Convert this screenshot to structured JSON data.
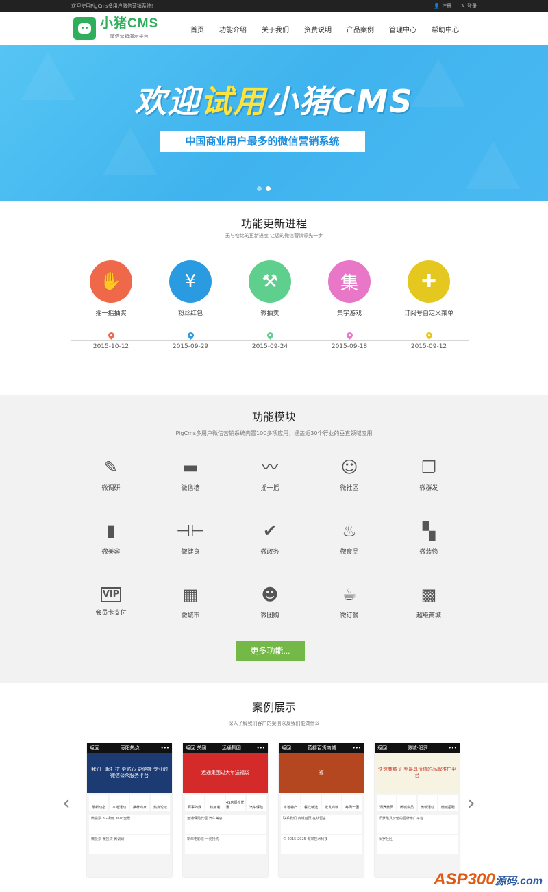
{
  "topbar": {
    "welcome": "欢迎使用PigCms多用户微信营销系统!",
    "register": "注册",
    "login": "登录"
  },
  "logo": {
    "title": "小猪CMS",
    "subtitle": "微信营销演示平台"
  },
  "nav": [
    "首页",
    "功能介绍",
    "关于我们",
    "资费说明",
    "产品案例",
    "管理中心",
    "帮助中心"
  ],
  "banner": {
    "title_prefix": "欢迎",
    "title_highlight": "试用",
    "title_suffix": "小猪CMS",
    "subtitle": "中国商业用户最多的微信营销系统"
  },
  "updates": {
    "title": "功能更新进程",
    "subtitle": "无与伦比的更新进度 让您的微信营销领先一步",
    "items": [
      {
        "label": "摇一摇抽奖",
        "date": "2015-10-12",
        "color": "#f0684a",
        "glyph": "✋"
      },
      {
        "label": "粉丝红包",
        "date": "2015-09-29",
        "color": "#2a9be0",
        "glyph": "¥"
      },
      {
        "label": "微拍卖",
        "date": "2015-09-24",
        "color": "#5fcf8e",
        "glyph": "⚒"
      },
      {
        "label": "集字游戏",
        "date": "2015-09-18",
        "color": "#e877c8",
        "glyph": "集"
      },
      {
        "label": "订阅号自定义菜单",
        "date": "2015-09-12",
        "color": "#e5c81f",
        "glyph": "✚"
      }
    ]
  },
  "modules": {
    "title": "功能模块",
    "subtitle": "PigCms多用户微信营销系统内置100多项应用，涵盖近30个行业的垂直领域应用",
    "items": [
      {
        "label": "微调研",
        "icon": "survey-icon",
        "glyph": "✎"
      },
      {
        "label": "微信墙",
        "icon": "wall-icon",
        "glyph": "▬"
      },
      {
        "label": "摇一摇",
        "icon": "shake-icon",
        "glyph": "〰"
      },
      {
        "label": "微社区",
        "icon": "community-icon",
        "glyph": "☺"
      },
      {
        "label": "微群发",
        "icon": "broadcast-icon",
        "glyph": "❐"
      },
      {
        "label": "微美容",
        "icon": "beauty-icon",
        "glyph": "▮"
      },
      {
        "label": "微健身",
        "icon": "fitness-icon",
        "glyph": "⊣⊢"
      },
      {
        "label": "微政务",
        "icon": "gov-icon",
        "glyph": "✔"
      },
      {
        "label": "微食品",
        "icon": "food-icon",
        "glyph": "♨"
      },
      {
        "label": "微装修",
        "icon": "paint-roller-icon",
        "glyph": "▚"
      },
      {
        "label": "会员卡支付",
        "icon": "vip-card-icon",
        "glyph": "VIP"
      },
      {
        "label": "微城市",
        "icon": "city-icon",
        "glyph": "▦"
      },
      {
        "label": "微团购",
        "icon": "group-buy-icon",
        "glyph": "☻"
      },
      {
        "label": "微订餐",
        "icon": "order-meal-icon",
        "glyph": "☕"
      },
      {
        "label": "超级商城",
        "icon": "qrcode-icon",
        "glyph": "▩"
      }
    ],
    "more_button": "更多功能..."
  },
  "cases": {
    "title": "案例展示",
    "subtitle": "深入了解我们客户的案例以及我们能做什么",
    "phones": [
      {
        "back": "返回",
        "title": "枣阳热点",
        "banner": "我们一起打拼 更贴心·更便捷 专业的微信公众服务平台",
        "banner_color": "#1c3b72",
        "cells": [
          "最新动态",
          "本地活动",
          "推荐商家",
          "热点论坛"
        ],
        "rows": [
          "微投票 3G相册 360°全景",
          "微投票 微投货 微调研"
        ]
      },
      {
        "back": "返回 关闭",
        "title": "远通集团",
        "banner": "远通集团过大年送福袋",
        "banner_color": "#d42a2a",
        "cells": [
          "百事的我",
          "热用着",
          "4S店保养优惠",
          "汽车保险"
        ],
        "rows": [
          "远通保险代理 汽车美容",
          "新年电影票 一元抢购"
        ]
      },
      {
        "back": "返回",
        "title": "药都百货商城",
        "banner": "福",
        "banner_color": "#b4471f",
        "cells": [
          "本地特产",
          "餐饮精选",
          "批发商城",
          "每周一团"
        ],
        "rows": [
          "联系我们 商城首页 在线留言",
          "© 2015-2025 专家技术科技"
        ]
      },
      {
        "back": "返回",
        "title": "微城·汨罗",
        "banner": "快速商城·汨罗最具价值的品牌推广平台",
        "banner_color": "#f7f3e3",
        "cells": [
          "汨罗黄页",
          "微城会员",
          "微城活动",
          "微城招聘"
        ],
        "rows": [
          "汨罗最具价值的品牌推广平台",
          "汨罗社区"
        ]
      }
    ]
  },
  "watermark": {
    "text": "ASP300",
    "suffix": "源码",
    "domain": ".com"
  }
}
